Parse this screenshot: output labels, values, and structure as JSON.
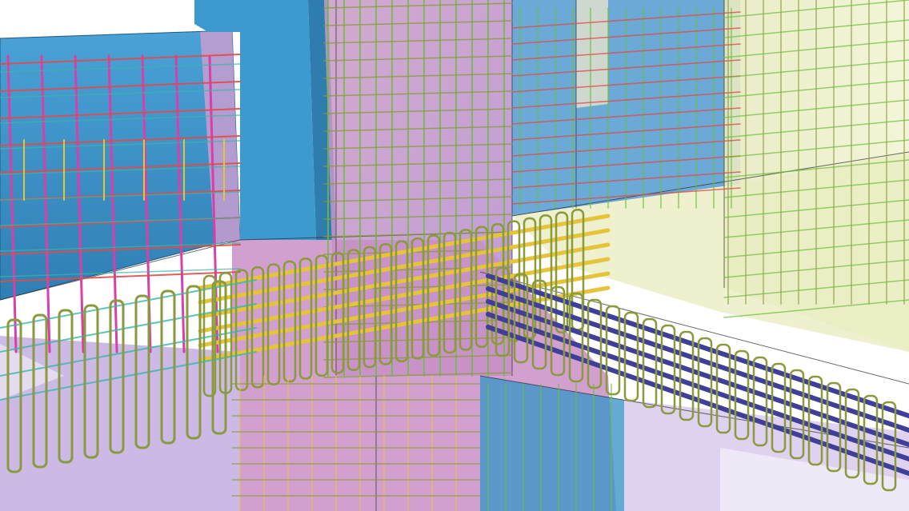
{
  "scene": {
    "colors": {
      "background": "#ffffff",
      "blue_concrete": "#3b91c6",
      "pink_concrete": "#c79bc4",
      "yellow_concrete": "#eef0c8",
      "lavender_concrete": "#c9b8e0",
      "rebar_yellow": "#e6c43a",
      "rebar_olive": "#8a9a3c",
      "rebar_magenta": "#d83fa8",
      "rebar_red": "#e04c4c",
      "rebar_teal": "#3ab6a8",
      "rebar_navy": "#3f3f9a",
      "rebar_green": "#6bbf3a",
      "edge_line": "#2b2b2b"
    }
  }
}
